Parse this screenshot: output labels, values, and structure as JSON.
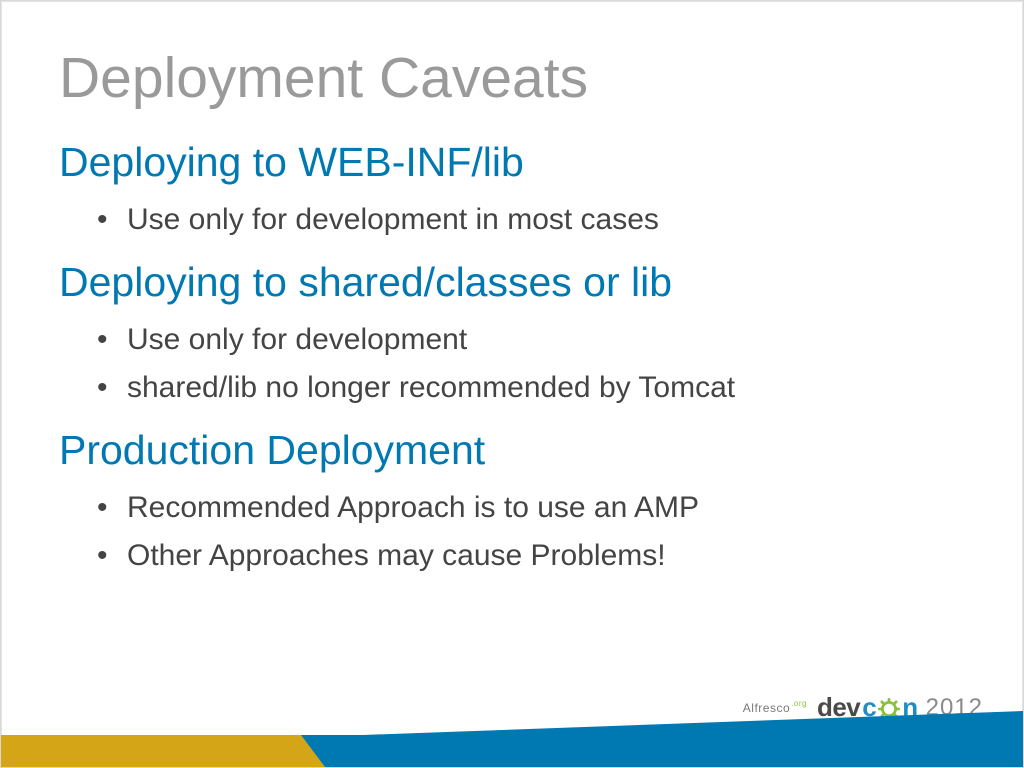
{
  "title": "Deployment Caveats",
  "sections": [
    {
      "heading": "Deploying to WEB-INF/lib",
      "bullets": [
        "Use only for development in most cases"
      ]
    },
    {
      "heading": "Deploying to shared/classes or lib",
      "bullets": [
        "Use only for development",
        "shared/lib no longer recommended by Tomcat"
      ]
    },
    {
      "heading": "Production Deployment",
      "bullets": [
        "Recommended Approach is to use an AMP",
        "Other Approaches may cause Problems!"
      ]
    }
  ],
  "logo": {
    "alfresco": "Alfresco",
    "org": ".org",
    "dev": "dev",
    "con": "n",
    "c_letter": "c",
    "year": "2012"
  },
  "colors": {
    "title_gray": "#9a9a9a",
    "heading_blue": "#0079b3",
    "body_gray": "#444444",
    "bar_blue": "#0079b3",
    "bar_gold": "#d4a516",
    "accent_green": "#8cbf3f"
  }
}
